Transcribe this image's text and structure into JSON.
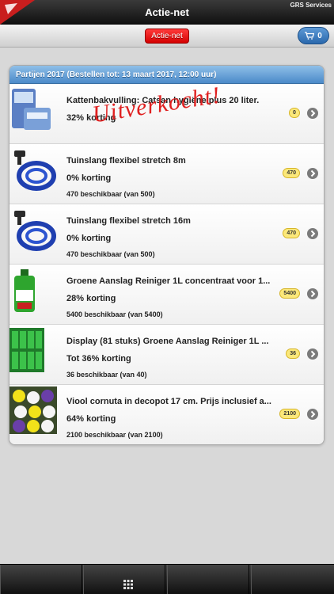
{
  "app": {
    "title": "Actie-net",
    "company": "GRS Services"
  },
  "toolbar": {
    "actie_label": "Actie-net",
    "cart_count": "0"
  },
  "panel": {
    "header": "Partijen 2017 (Bestellen tot: 13 maart 2017, 12:00 uur)",
    "sold_out_label": "Uitverkocht!"
  },
  "items": [
    {
      "name": "Kattenbakvulling: Catsan hygiëne plus 20 liter.",
      "discount": "32% korting",
      "availability": "",
      "badge": "0"
    },
    {
      "name": "Tuinslang flexibel stretch 8m",
      "discount": "0% korting",
      "availability": "470 beschikbaar (van 500)",
      "badge": "470"
    },
    {
      "name": "Tuinslang flexibel stretch 16m",
      "discount": "0% korting",
      "availability": "470 beschikbaar (van 500)",
      "badge": "470"
    },
    {
      "name": "Groene Aanslag Reiniger 1L concentraat voor 1...",
      "discount": "28% korting",
      "availability": "5400 beschikbaar (van 5400)",
      "badge": "5400"
    },
    {
      "name": "Display (81 stuks) Groene Aanslag Reiniger 1L ...",
      "discount": "Tot 36% korting",
      "availability": "36 beschikbaar (van 40)",
      "badge": "36"
    },
    {
      "name": "Viool cornuta in decopot 17 cm. Prijs inclusief a...",
      "discount": "64% korting",
      "availability": "2100 beschikbaar (van 2100)",
      "badge": "2100"
    }
  ],
  "icons": {
    "cart": "cart-icon",
    "chevron": "chevron-right-icon",
    "grid": "grid-icon"
  },
  "colors": {
    "accent_blue": "#4b8ac9",
    "sold_red": "#e02020",
    "badge_yellow": "#fbe87a"
  }
}
